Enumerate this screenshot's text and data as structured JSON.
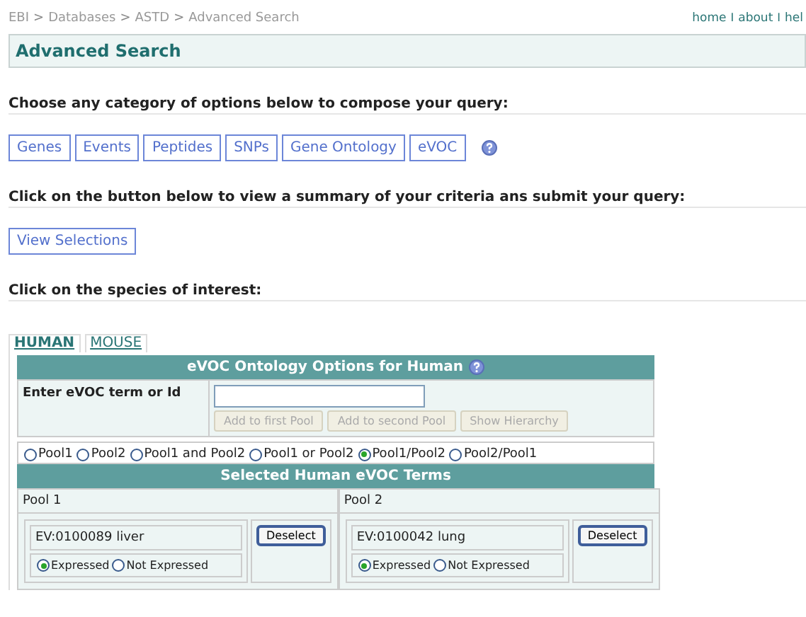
{
  "breadcrumb": [
    {
      "label": "EBI"
    },
    {
      "separator": ">",
      "label": "Databases"
    },
    {
      "separator": ">",
      "label": "ASTD"
    },
    {
      "separator": ">",
      "label": "Advanced Search"
    }
  ],
  "top_links": [
    {
      "label": "home"
    },
    {
      "separator": "I",
      "label": "about"
    },
    {
      "separator": "I",
      "label": "hel"
    }
  ],
  "page_title": "Advanced Search",
  "sections": [
    {
      "heading": "Choose any category of options below to compose your query:"
    },
    {
      "heading": "Click on the button below to view a summary of your criteria ans submit your query:"
    },
    {
      "heading": "Click on the species of interest:"
    }
  ],
  "category_buttons": [
    "Genes",
    "Events",
    "Peptides",
    "SNPs",
    "Gene Ontology",
    "eVOC"
  ],
  "view_button": "View Selections",
  "species_tabs": [
    {
      "label": "HUMAN",
      "selected": true
    },
    {
      "label": "MOUSE",
      "selected": false
    }
  ],
  "panel": {
    "title": "eVOC Ontology Options for Human",
    "term_label": "Enter eVOC term or Id",
    "actions": [
      {
        "label": "Add to first Pool",
        "disabled": true
      },
      {
        "label": "Add to second Pool",
        "disabled": true
      },
      {
        "label": "Show Hierarchy",
        "disabled": true
      }
    ],
    "combine_options": [
      {
        "label": "Pool1",
        "selected": false
      },
      {
        "label": "Pool2",
        "selected": false
      },
      {
        "label": "Pool1 and Pool2",
        "selected": false
      },
      {
        "label": "Pool1 or Pool2",
        "selected": false
      },
      {
        "label": "Pool1/Pool2",
        "selected": true
      },
      {
        "label": "Pool2/Pool1",
        "selected": false
      }
    ],
    "selected_title": "Selected Human eVOC Terms",
    "pools": [
      {
        "name": "Pool 1",
        "terms": [
          {
            "term": "EV:0100089 liver",
            "button": "Deselect",
            "options": [
              {
                "label": "Expressed",
                "selected": true
              },
              {
                "label": "Not Expressed",
                "selected": false
              }
            ]
          }
        ]
      },
      {
        "name": "Pool 2",
        "terms": [
          {
            "term": "EV:0100042 lung",
            "button": "Deselect",
            "options": [
              {
                "label": "Expressed",
                "selected": true
              },
              {
                "label": "Not Expressed",
                "selected": false
              }
            ]
          }
        ]
      }
    ]
  }
}
